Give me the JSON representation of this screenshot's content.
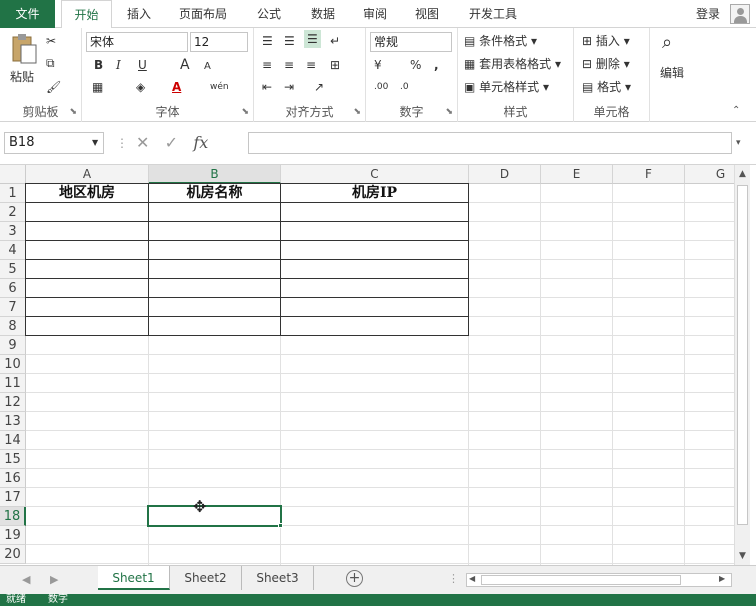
{
  "ribbon_tabs": [
    "文件",
    "开始",
    "插入",
    "页面布局",
    "公式",
    "数据",
    "审阅",
    "视图",
    "开发工具"
  ],
  "login": "登录",
  "clipboard": {
    "paste": "粘贴",
    "label": "剪贴板"
  },
  "font": {
    "name": "宋体",
    "size": "12",
    "label": "字体",
    "bold": "B",
    "italic": "I",
    "underline": "U",
    "grow": "A",
    "shrink": "A",
    "phonetic": "wén"
  },
  "alignment": {
    "label": "对齐方式"
  },
  "number": {
    "format": "常规",
    "percent": "%",
    "comma": ",",
    "label": "数字"
  },
  "styles": {
    "conditional": "条件格式",
    "table": "套用表格格式",
    "cell": "单元格样式",
    "label": "样式"
  },
  "cells": {
    "insert": "插入",
    "delete": "删除",
    "format": "格式",
    "label": "单元格"
  },
  "editing": {
    "label": "编辑"
  },
  "formula_bar": {
    "name_box": "B18",
    "fx": "fx",
    "value": ""
  },
  "columns": [
    "A",
    "B",
    "C",
    "D",
    "E",
    "F",
    "G"
  ],
  "rows": [
    "1",
    "2",
    "3",
    "4",
    "5",
    "6",
    "7",
    "8",
    "9",
    "10",
    "11",
    "12",
    "13",
    "14",
    "15",
    "16",
    "17",
    "18",
    "19",
    "20"
  ],
  "header_cells": {
    "a1": "地区机房",
    "b1": "机房名称",
    "c1": "机房IP"
  },
  "selected_cell": "B18",
  "sheets": [
    "Sheet1",
    "Sheet2",
    "Sheet3"
  ],
  "active_sheet": "Sheet1",
  "status_bar": {
    "ready": "就绪",
    "mode": "数字"
  },
  "colors": {
    "accent": "#217346"
  }
}
